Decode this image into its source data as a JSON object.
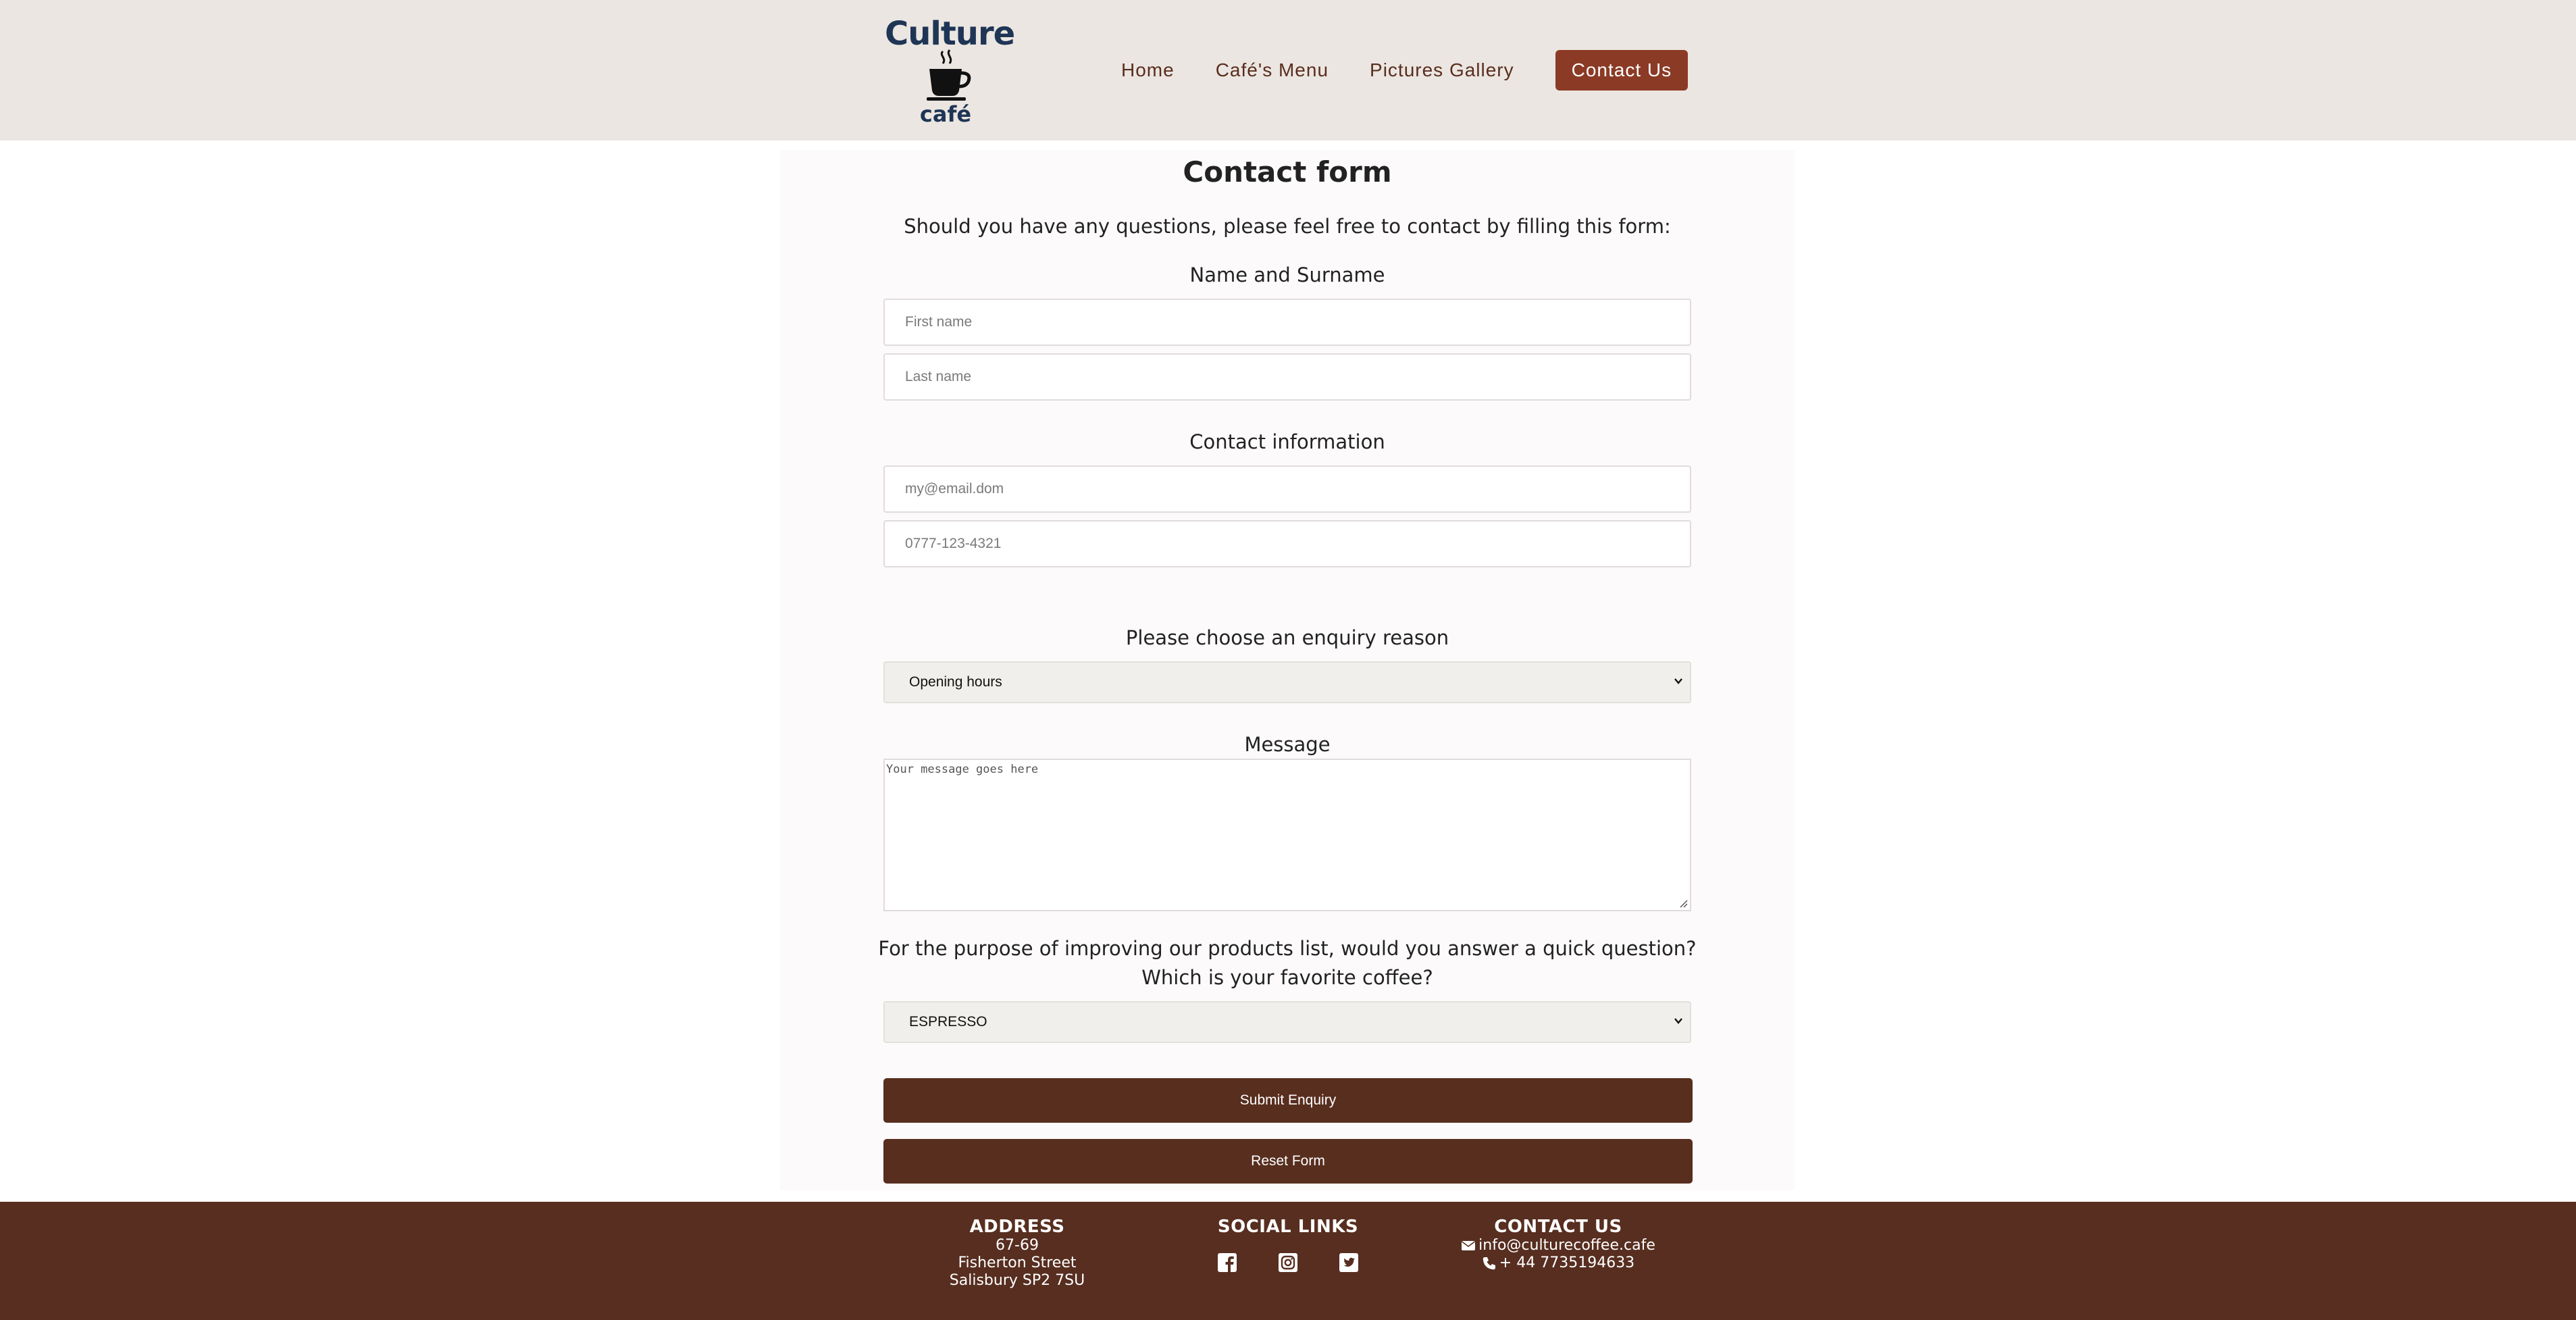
{
  "header": {
    "logo": {
      "word_top": "Culture",
      "word_bottom": "café"
    },
    "nav": [
      {
        "label": "Home"
      },
      {
        "label": "Café's Menu"
      },
      {
        "label": "Pictures Gallery"
      },
      {
        "label": "Contact Us",
        "active": true
      }
    ]
  },
  "form": {
    "title": "Contact form",
    "intro": "Should you have any questions, please feel free to contact by filling this form:",
    "name_section": {
      "label": "Name and Surname",
      "first_placeholder": "First name",
      "last_placeholder": "Last name"
    },
    "contact_section": {
      "label": "Contact information",
      "email_placeholder": "my@email.dom",
      "phone_placeholder": "0777-123-4321"
    },
    "enquiry": {
      "label": "Please choose an enquiry reason",
      "selected": "Opening hours"
    },
    "message": {
      "label": "Message",
      "placeholder": "Your message goes here"
    },
    "survey": {
      "question_line1": "For the purpose of improving our products list, would you answer a quick question?",
      "question_line2": "Which is your favorite coffee?",
      "selected": "ESPRESSO"
    },
    "submit_label": "Submit Enquiry",
    "reset_label": "Reset Form"
  },
  "footer": {
    "address": {
      "heading": "ADDRESS",
      "line1": "67-69",
      "line2": "Fisherton Street",
      "line3": "Salisbury SP2 7SU"
    },
    "social": {
      "heading": "SOCIAL LINKS",
      "icons": [
        "facebook-icon",
        "instagram-icon",
        "twitter-icon"
      ]
    },
    "contact": {
      "heading": "CONTACT US",
      "email": "info@culturecoffee.cafe",
      "phone": "+ 44 7735194633"
    }
  },
  "colors": {
    "header_bg": "#ebe6e1",
    "nav_text": "#5a2d1e",
    "nav_active_bg": "#8b3a25",
    "button_bg": "#582e1f",
    "footer_bg": "#572e20",
    "logo_blue": "#1f3556"
  }
}
